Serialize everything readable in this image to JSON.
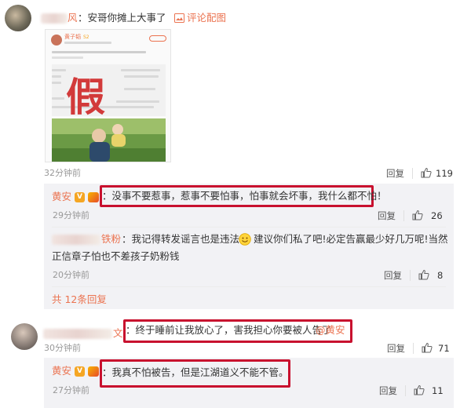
{
  "comments": [
    {
      "id": "top",
      "name_tail": "风",
      "text": "：安哥你摊上大事了",
      "image_link": "评论配图",
      "thumb": {
        "username": "黄子韬",
        "badge": "S2",
        "watermark": "假"
      },
      "time": "32分钟前",
      "reply_label": "回复",
      "likes": "119"
    },
    {
      "id": "sub-1",
      "name": "黄安",
      "verified_badge": "V",
      "text": "：没事不要惹事，惹事不要怕事，怕事就会坏事，我什么都不怕！",
      "time": "29分钟前",
      "reply_label": "回复",
      "likes": "26"
    },
    {
      "id": "sub-2",
      "name_tail": "铁粉",
      "text_line1": "：我记得转发谣言也是违法",
      "text_line1b": "建议你们私了吧!必定告赢最少好几万呢!当然",
      "text_line2": "正信章子怕也不差孩子奶粉钱",
      "time": "20分钟前",
      "reply_label": "回复",
      "likes": "8"
    },
    {
      "id": "more",
      "text": "共 12条回复"
    },
    {
      "id": "c2",
      "name_tail": "文",
      "text": "：终于睡前让我放心了，害我担心你要被人告了",
      "mention": "@黄安",
      "time": "30分钟前",
      "reply_label": "回复",
      "likes": "71"
    },
    {
      "id": "sub-3",
      "name": "黄安",
      "verified_badge": "V",
      "text": "：我真不怕被告，但是江湖道义不能不管。",
      "time": "27分钟前",
      "reply_label": "回复",
      "likes": "11"
    }
  ],
  "colors": {
    "link": "#eb7350",
    "highlight_box": "#c8102e",
    "sub_bg": "#f2f2f5",
    "time": "#999999"
  },
  "icons": {
    "like": "thumbs-up-icon",
    "image": "image-icon",
    "emoji": "smile-emoji-icon",
    "verified": "verified-v-icon"
  }
}
